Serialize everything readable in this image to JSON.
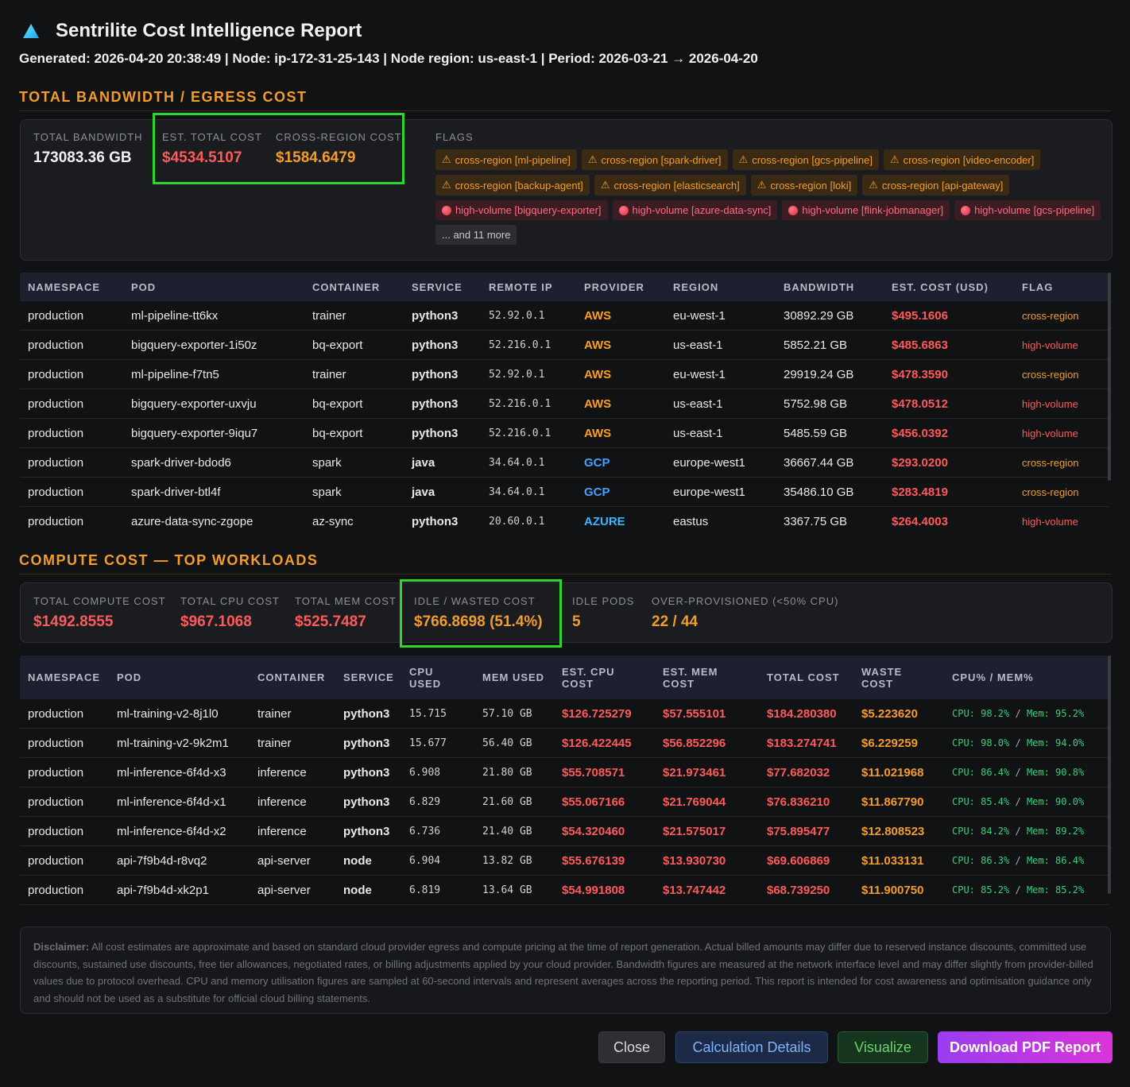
{
  "header": {
    "title": "Sentrilite Cost Intelligence Report",
    "subtitle": "Generated: 2026-04-20 20:38:49 | Node: ip-172-31-25-143 | Node region: us-east-1 | Period: 2026-03-21 → 2026-04-20"
  },
  "bandwidth": {
    "section_title": "TOTAL BANDWIDTH / EGRESS COST",
    "total_bandwidth_label": "TOTAL BANDWIDTH",
    "total_bandwidth_value": "173083.36 GB",
    "est_total_cost_label": "EST. TOTAL COST",
    "est_total_cost_value": "$4534.5107",
    "cross_region_cost_label": "CROSS-REGION COST",
    "cross_region_cost_value": "$1584.6479",
    "flags_label": "FLAGS",
    "flags": [
      {
        "type": "warn",
        "icon": "warning-icon",
        "text": "cross-region [ml-pipeline]"
      },
      {
        "type": "warn",
        "icon": "warning-icon",
        "text": "cross-region [spark-driver]"
      },
      {
        "type": "warn",
        "icon": "warning-icon",
        "text": "cross-region [gcs-pipeline]"
      },
      {
        "type": "warn",
        "icon": "warning-icon",
        "text": "cross-region [video-encoder]"
      },
      {
        "type": "warn",
        "icon": "warning-icon",
        "text": "cross-region [backup-agent]"
      },
      {
        "type": "warn",
        "icon": "warning-icon",
        "text": "cross-region [elasticsearch]"
      },
      {
        "type": "warn",
        "icon": "warning-icon",
        "text": "cross-region [loki]"
      },
      {
        "type": "warn",
        "icon": "warning-icon",
        "text": "cross-region [api-gateway]"
      },
      {
        "type": "high",
        "icon": "red-circle-icon",
        "text": "high-volume [bigquery-exporter]"
      },
      {
        "type": "high",
        "icon": "red-circle-icon",
        "text": "high-volume [azure-data-sync]"
      },
      {
        "type": "high",
        "icon": "red-circle-icon",
        "text": "high-volume [flink-jobmanager]"
      },
      {
        "type": "high",
        "icon": "red-circle-icon",
        "text": "high-volume [gcs-pipeline]"
      },
      {
        "type": "more",
        "icon": "",
        "text": "... and 11 more"
      }
    ],
    "table": {
      "headers": [
        "NAMESPACE",
        "POD",
        "CONTAINER",
        "SERVICE",
        "REMOTE IP",
        "PROVIDER",
        "REGION",
        "BANDWIDTH",
        "EST. COST (USD)",
        "FLAG"
      ],
      "rows": [
        [
          "production",
          "ml-pipeline-tt6kx",
          "trainer",
          "python3",
          "52.92.0.1",
          "AWS",
          "eu-west-1",
          "30892.29 GB",
          "$495.1606",
          "cross-region"
        ],
        [
          "production",
          "bigquery-exporter-1i50z",
          "bq-export",
          "python3",
          "52.216.0.1",
          "AWS",
          "us-east-1",
          "5852.21 GB",
          "$485.6863",
          "high-volume"
        ],
        [
          "production",
          "ml-pipeline-f7tn5",
          "trainer",
          "python3",
          "52.92.0.1",
          "AWS",
          "eu-west-1",
          "29919.24 GB",
          "$478.3590",
          "cross-region"
        ],
        [
          "production",
          "bigquery-exporter-uxvju",
          "bq-export",
          "python3",
          "52.216.0.1",
          "AWS",
          "us-east-1",
          "5752.98 GB",
          "$478.0512",
          "high-volume"
        ],
        [
          "production",
          "bigquery-exporter-9iqu7",
          "bq-export",
          "python3",
          "52.216.0.1",
          "AWS",
          "us-east-1",
          "5485.59 GB",
          "$456.0392",
          "high-volume"
        ],
        [
          "production",
          "spark-driver-bdod6",
          "spark",
          "java",
          "34.64.0.1",
          "GCP",
          "europe-west1",
          "36667.44 GB",
          "$293.0200",
          "cross-region"
        ],
        [
          "production",
          "spark-driver-btl4f",
          "spark",
          "java",
          "34.64.0.1",
          "GCP",
          "europe-west1",
          "35486.10 GB",
          "$283.4819",
          "cross-region"
        ],
        [
          "production",
          "azure-data-sync-zgope",
          "az-sync",
          "python3",
          "20.60.0.1",
          "AZURE",
          "eastus",
          "3367.75 GB",
          "$264.4003",
          "high-volume"
        ]
      ]
    }
  },
  "compute": {
    "section_title": "COMPUTE COST — TOP WORKLOADS",
    "stats": [
      {
        "label": "TOTAL COMPUTE COST",
        "value": "$1492.8555"
      },
      {
        "label": "TOTAL CPU COST",
        "value": "$967.1068"
      },
      {
        "label": "TOTAL MEM COST",
        "value": "$525.7487"
      },
      {
        "label": "IDLE / WASTED COST",
        "value": "$766.8698 (51.4%)"
      },
      {
        "label": "IDLE PODS",
        "value": "5"
      },
      {
        "label": "OVER-PROVISIONED (<50% CPU)",
        "value": "22 / 44"
      }
    ],
    "table": {
      "headers": [
        "NAMESPACE",
        "POD",
        "CONTAINER",
        "SERVICE",
        "CPU USED",
        "MEM USED",
        "EST. CPU COST",
        "EST. MEM COST",
        "TOTAL COST",
        "WASTE COST",
        "CPU% / MEM%"
      ],
      "rows": [
        [
          "production",
          "ml-training-v2-8j1l0",
          "trainer",
          "python3",
          "15.715",
          "57.10 GB",
          "$126.725279",
          "$57.555101",
          "$184.280380",
          "$5.223620",
          "CPU: 98.2%",
          "Mem: 95.2%"
        ],
        [
          "production",
          "ml-training-v2-9k2m1",
          "trainer",
          "python3",
          "15.677",
          "56.40 GB",
          "$126.422445",
          "$56.852296",
          "$183.274741",
          "$6.229259",
          "CPU: 98.0%",
          "Mem: 94.0%"
        ],
        [
          "production",
          "ml-inference-6f4d-x3",
          "inference",
          "python3",
          "6.908",
          "21.80 GB",
          "$55.708571",
          "$21.973461",
          "$77.682032",
          "$11.021968",
          "CPU: 86.4%",
          "Mem: 90.8%"
        ],
        [
          "production",
          "ml-inference-6f4d-x1",
          "inference",
          "python3",
          "6.829",
          "21.60 GB",
          "$55.067166",
          "$21.769044",
          "$76.836210",
          "$11.867790",
          "CPU: 85.4%",
          "Mem: 90.0%"
        ],
        [
          "production",
          "ml-inference-6f4d-x2",
          "inference",
          "python3",
          "6.736",
          "21.40 GB",
          "$54.320460",
          "$21.575017",
          "$75.895477",
          "$12.808523",
          "CPU: 84.2%",
          "Mem: 89.2%"
        ],
        [
          "production",
          "api-7f9b4d-r8vq2",
          "api-server",
          "node",
          "6.904",
          "13.82 GB",
          "$55.676139",
          "$13.930730",
          "$69.606869",
          "$11.033131",
          "CPU: 86.3%",
          "Mem: 86.4%"
        ],
        [
          "production",
          "api-7f9b4d-xk2p1",
          "api-server",
          "node",
          "6.819",
          "13.64 GB",
          "$54.991808",
          "$13.747442",
          "$68.739250",
          "$11.900750",
          "CPU: 85.2%",
          "Mem: 85.2%"
        ]
      ]
    }
  },
  "disclaimer": {
    "label": "Disclaimer:",
    "text": "All cost estimates are approximate and based on standard cloud provider egress and compute pricing at the time of report generation. Actual billed amounts may differ due to reserved instance discounts, committed use discounts, sustained use discounts, free tier allowances, negotiated rates, or billing adjustments applied by your cloud provider. Bandwidth figures are measured at the network interface level and may differ slightly from provider-billed values due to protocol overhead. CPU and memory utilisation figures are sampled at 60-second intervals and represent averages across the reporting period. This report is intended for cost awareness and optimisation guidance only and should not be used as a substitute for official cloud billing statements."
  },
  "buttons": {
    "close": "Close",
    "calc": "Calculation Details",
    "visualize": "Visualize",
    "pdf": "Download PDF Report"
  },
  "colors": {
    "accent_orange": "#f39c2b",
    "cost_red": "#ff5a5a",
    "highlight_green": "#2ed52e"
  }
}
